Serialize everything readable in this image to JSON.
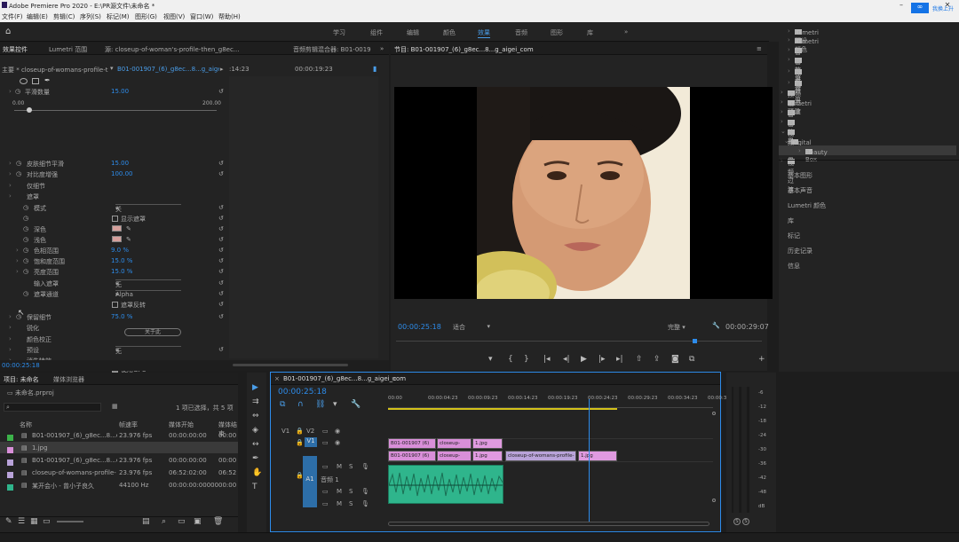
{
  "app": {
    "title": "Adobe Premiere Pro 2020 - E:\\PR源文件\\未命名 *"
  },
  "menu": [
    "文件(F)",
    "编辑(E)",
    "剪辑(C)",
    "序列(S)",
    "标记(M)",
    "图形(G)",
    "视图(V)",
    "窗口(W)",
    "帮助(H)"
  ],
  "workspaces": [
    "学习",
    "组件",
    "编辑",
    "颜色",
    "效果",
    "音频",
    "图形",
    "库"
  ],
  "active_workspace": "效果",
  "top_right": {
    "user_hint": "hello",
    "share_label": "我换上升"
  },
  "effect_controls": {
    "tabs": [
      "效果控件",
      "Lumetri 范围",
      "源: closeup-of-woman's-profile-then_g8ec...",
      "音频剪辑混合器: B01-0019"
    ],
    "master": "主要 * closeup-of-womans-profile-then...",
    "seq_clip": "B01-001907_(6)_g8ec...8...g_aigei...",
    "tc_start": ":14:23",
    "tc_end": "00:00:19:23",
    "slider_min": "0.00",
    "slider_max": "200.00",
    "rows": [
      {
        "label": "平滑数量",
        "value": "15.00"
      },
      {
        "label": "皮肤细节平滑",
        "value": "15.00"
      },
      {
        "label": "对比度增强",
        "value": "100.00"
      },
      {
        "label": "仅细节",
        "value": ""
      },
      {
        "label": "遮罩",
        "value": ""
      },
      {
        "label": "模式",
        "value": "关"
      },
      {
        "label": "",
        "value": "显示遮罩"
      },
      {
        "label": "深色",
        "value": ""
      },
      {
        "label": "浅色",
        "value": ""
      },
      {
        "label": "色相范围",
        "value": "9.0 %"
      },
      {
        "label": "饱和度范围",
        "value": "15.0 %"
      },
      {
        "label": "亮度范围",
        "value": "15.0 %"
      },
      {
        "label": "输入遮罩",
        "value": "无"
      },
      {
        "label": "遮罩通道",
        "value": "Alpha"
      },
      {
        "label": "",
        "value": "遮罩反转"
      },
      {
        "label": "保留细节",
        "value": "75.0 %"
      },
      {
        "label": "锐化",
        "value": ""
      },
      {
        "label": "颜色校正",
        "value": ""
      },
      {
        "label": "预设",
        "value": "无"
      },
      {
        "label": "消失特效",
        "value": ""
      },
      {
        "label": "",
        "value": "使用GPU"
      }
    ],
    "about_btn": "关于此",
    "bottom_tc": "00:00:25:18"
  },
  "program_monitor": {
    "title": "节目: B01-001907_(6)_g8ec...8...g_aigei_com",
    "tc_current": "00:00:25:18",
    "fit": "适合",
    "quality": "完整",
    "tc_duration": "00:00:29:07",
    "playhead_pct": 0.81
  },
  "project": {
    "tabs": [
      "项目: 未命名",
      "媒体浏览器"
    ],
    "file": "未命名.prproj",
    "selection": "1 项已选择，共 5 项",
    "cols": [
      "名称",
      "帧速率",
      "媒体开始",
      "媒体结束"
    ],
    "items": [
      {
        "name": "B01-001907_(6)_g8ec...8...c",
        "fps": "23.976 fps",
        "start": "00:00:00:00",
        "end": "00:00",
        "color": "#3cb34a"
      },
      {
        "name": "1.jpg",
        "fps": "",
        "start": "",
        "end": "",
        "color": "#d98fd9"
      },
      {
        "name": "B01-001907_(6)_g8ec...8...c",
        "fps": "23.976 fps",
        "start": "00:00:00:00",
        "end": "00:00",
        "color": "#b9a3d9"
      },
      {
        "name": "closeup-of-womans-profile-",
        "fps": "23.976 fps",
        "start": "06:52:02:00",
        "end": "06:52",
        "color": "#b9a3d9"
      },
      {
        "name": "某开会小 - 曾小子良久",
        "fps": "44100 Hz",
        "start": "00:00:00:00000",
        "end": "00:00",
        "color": "#2fb58c"
      }
    ]
  },
  "timeline": {
    "tab": "B01-001907_(6)_g8ec...8...g_aigei_com",
    "tc": "00:00:25:18",
    "ruler": [
      "00:00",
      "00:00:04:23",
      "00:00:09:23",
      "00:00:14:23",
      "00:00:19:23",
      "00:00:24:23",
      "00:00:29:23",
      "00:00:34:23",
      "00:00:39:"
    ],
    "tracks": {
      "v2": "V2",
      "v1": "V1",
      "a1": "A1",
      "src_v": "V1",
      "src_a": "A1",
      "audio_name": "音频 1"
    },
    "clips_v2": [
      "B01-001907 (6)",
      "closeup-",
      "1.jpg"
    ],
    "clips_v1": [
      "B01-001907 (6)",
      "closeup-",
      "1.jpg",
      "closeup-of-womans-profile-",
      "1.jpg"
    ]
  },
  "effects_panel": {
    "items": [
      "Lumetri 预设",
      "Lumetri 颜色",
      "音频效果",
      "音频过渡",
      "视频效果",
      "视频过渡",
      "预设",
      "Lumetri 预设",
      "音频效果",
      "音频过渡",
      "视频效果",
      "Digital Anarchy",
      "Beauty Box",
      "视频过渡"
    ],
    "lower": [
      "基本图形",
      "基本声音",
      "Lumetri 颜色",
      "库",
      "标记",
      "历史记录",
      "信息"
    ]
  },
  "meter": {
    "labels": [
      "-6",
      "-12",
      "-18",
      "-24",
      "-30",
      "-36",
      "-42",
      "-48",
      "dB"
    ],
    "solo": "S",
    "solo2": "S"
  },
  "colors": {
    "accent": "#2d8ceb",
    "video": "#d98fd9",
    "audio": "#2fb58c"
  }
}
